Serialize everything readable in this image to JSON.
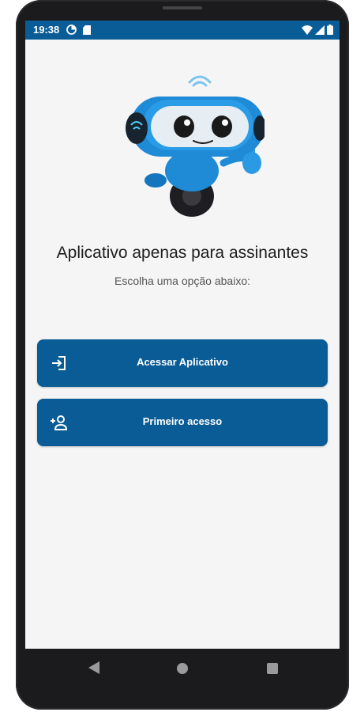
{
  "status_bar": {
    "time": "19:38",
    "left_icons": [
      "data-saver-icon",
      "sd-card-icon"
    ],
    "right_icons": [
      "wifi-icon",
      "cell-signal-icon",
      "battery-icon"
    ]
  },
  "main": {
    "mascot": "robot-mascot",
    "title": "Aplicativo apenas para assinantes",
    "subtitle": "Escolha uma opção abaixo:"
  },
  "buttons": {
    "access": {
      "label": "Acessar Aplicativo",
      "icon": "login-icon"
    },
    "first_access": {
      "label": "Primeiro acesso",
      "icon": "person-add-icon"
    }
  },
  "nav_bar": {
    "buttons": [
      "back-icon",
      "home-icon",
      "recents-icon"
    ]
  },
  "colors": {
    "primary": "#0a5c96",
    "background": "#f5f5f5",
    "title_text": "#1d1d1d",
    "subtitle_text": "#555555"
  }
}
